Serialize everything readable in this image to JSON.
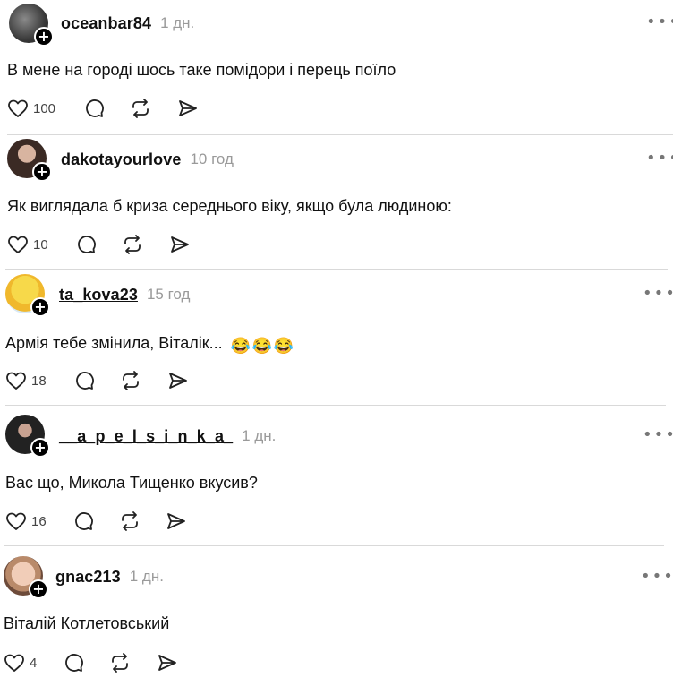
{
  "posts": [
    {
      "username": "oceanbar84",
      "time": "1 дн.",
      "text": "В мене на городі шось таке помідори і перець поїло",
      "likes": "100",
      "avatar": "avatar-photo-dark",
      "underline": false
    },
    {
      "username": "dakotayourlove",
      "time": "10 год",
      "text": "Як виглядала б криза середнього віку, якщо була людиною:",
      "likes": "10",
      "avatar": "avatar-photo-woman",
      "underline": false
    },
    {
      "username": "ta_kova23",
      "time": "15 год",
      "text": "Армія тебе змінила, Віталік... ",
      "likes": "18",
      "avatar": "avatar-chick-cartoon",
      "underline": true,
      "emojis": [
        "😂",
        "😂",
        "😂"
      ]
    },
    {
      "username": "__a_p_e_l_s_i_n_k_a_",
      "time": "1 дн.",
      "text": "Вас що, Микола Тищенко вкусив?",
      "likes": "16",
      "avatar": "avatar-photo-dark-woman",
      "underline": true
    },
    {
      "username": "gnac213",
      "time": "1 дн.",
      "text": "Віталій Котлетовський",
      "likes": "4",
      "avatar": "avatar-doll-face",
      "underline": false
    }
  ],
  "icons": {
    "like": "heart-icon",
    "comment": "comment-icon",
    "repost": "repost-icon",
    "share": "share-icon",
    "more": "more-options-icon",
    "follow": "follow-plus-icon"
  },
  "colors": {
    "text": "#111111",
    "muted": "#9a9a9a",
    "divider": "#d9d9d9",
    "emoji": "#f5c33b"
  }
}
